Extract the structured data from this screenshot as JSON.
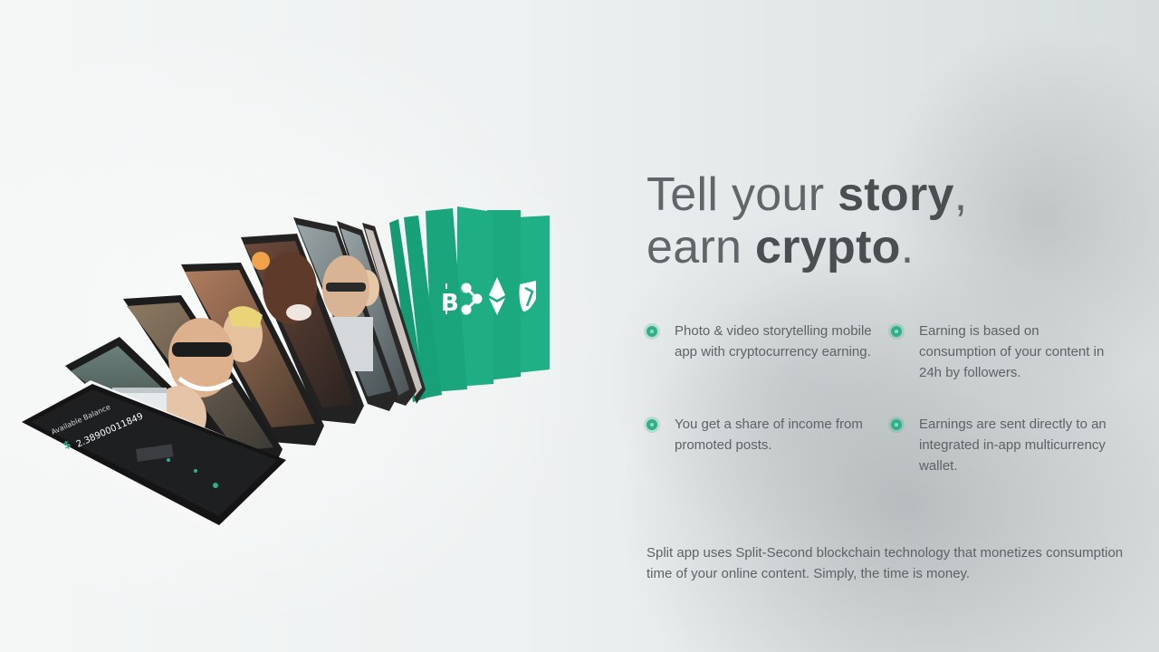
{
  "headline": {
    "line1_light": "Tell your ",
    "line1_bold": "story",
    "line1_end": ",",
    "line2_light": "earn ",
    "line2_bold": "crypto",
    "line2_end": "."
  },
  "features": [
    {
      "text": "Photo & video storytelling mobile app with cryptocurrency earning."
    },
    {
      "text": "Earning is based on consumption of your content in 24h by followers."
    },
    {
      "text": "You get a share of income from promoted posts."
    },
    {
      "text": "Earnings are sent directly to an integrated in-app multicurrency wallet."
    }
  ],
  "description": "Split app uses Split-Second blockchain technology that monetizes consumption time of your online content. Simply, the time is money.",
  "colors": {
    "accent": "#2fb08b",
    "card_green": "#1fae84",
    "text": "#5d6366",
    "heading": "#4a4f52"
  },
  "illustration": {
    "wallet_amount": "2.38900011849",
    "card_icons": [
      "bitcoin-icon",
      "ripple-icon",
      "ethereum-classic-icon",
      "shield-icon"
    ]
  }
}
